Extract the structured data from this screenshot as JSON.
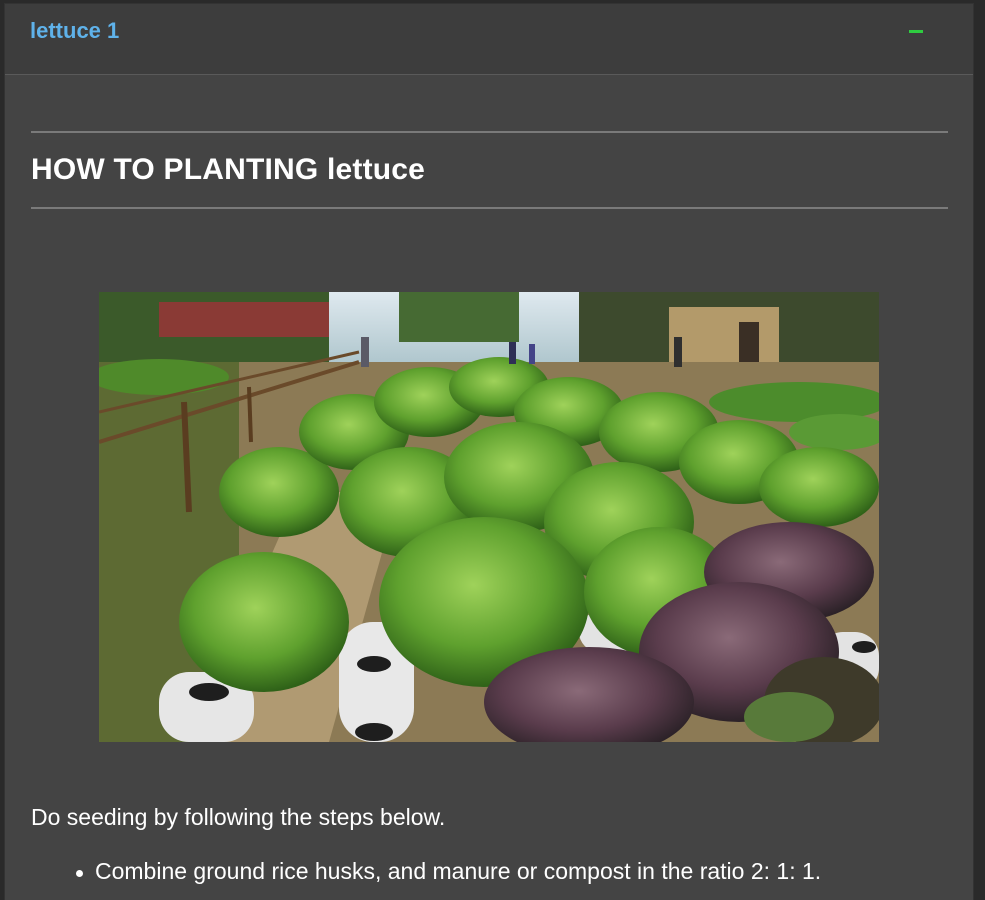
{
  "panel": {
    "title": "lettuce 1",
    "collapse_icon": "minus-icon"
  },
  "article": {
    "heading": "HOW TO PLANTING lettuce",
    "image_description_icon": "photo-hydroponic-lettuce",
    "intro": "Do seeding by following the steps below.",
    "steps": [
      "Combine ground rice husks, and manure or compost in the ratio 2: 1: 1."
    ]
  },
  "colors": {
    "title": "#5fb2ea",
    "collapse": "#2ecc40",
    "panel_bg": "#444444",
    "text": "#ffffff"
  }
}
